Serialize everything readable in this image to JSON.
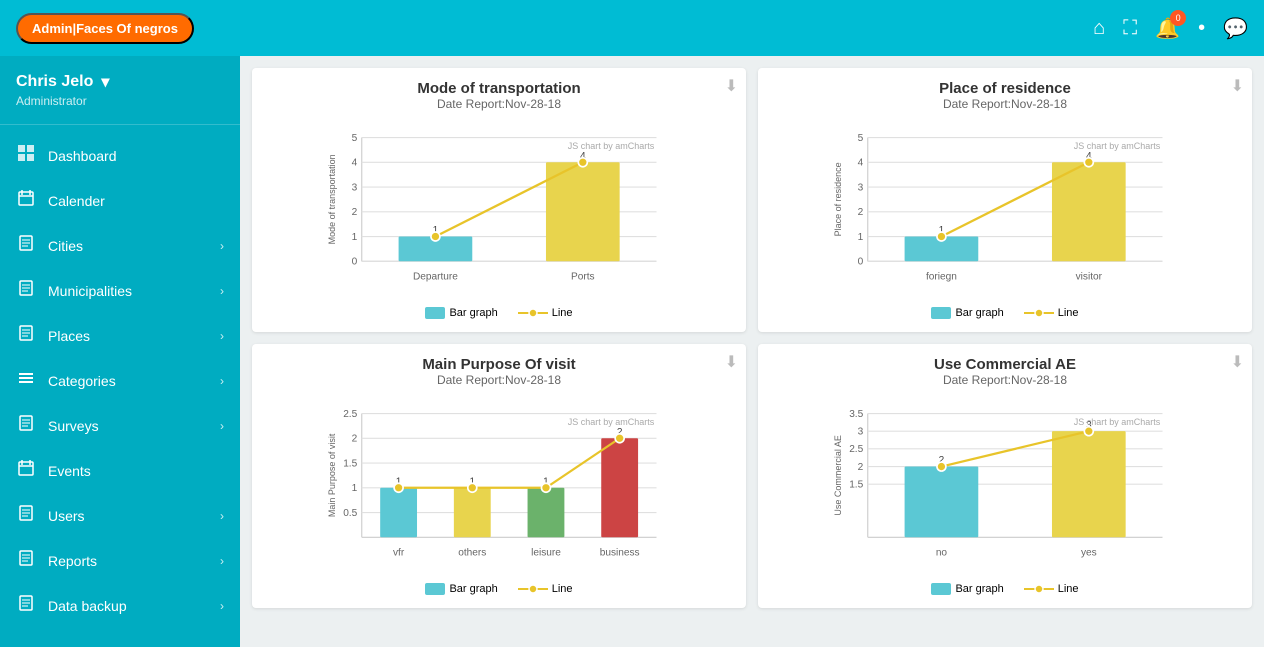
{
  "navbar": {
    "brand": "Admin|Faces Of negros",
    "icons": [
      "home",
      "expand",
      "bell",
      "user",
      "chat"
    ],
    "badge_count": "0"
  },
  "sidebar": {
    "user": {
      "name": "Chris Jelo",
      "role": "Administrator"
    },
    "items": [
      {
        "id": "dashboard",
        "label": "Dashboard",
        "icon": "▦",
        "has_arrow": false
      },
      {
        "id": "calender",
        "label": "Calender",
        "icon": "📅",
        "has_arrow": false
      },
      {
        "id": "cities",
        "label": "Cities",
        "icon": "📄",
        "has_arrow": true
      },
      {
        "id": "municipalities",
        "label": "Municipalities",
        "icon": "📄",
        "has_arrow": true
      },
      {
        "id": "places",
        "label": "Places",
        "icon": "📄",
        "has_arrow": true
      },
      {
        "id": "categories",
        "label": "Categories",
        "icon": "≡",
        "has_arrow": true
      },
      {
        "id": "surveys",
        "label": "Surveys",
        "icon": "📄",
        "has_arrow": true
      },
      {
        "id": "events",
        "label": "Events",
        "icon": "📅",
        "has_arrow": false
      },
      {
        "id": "users",
        "label": "Users",
        "icon": "📄",
        "has_arrow": true
      },
      {
        "id": "reports",
        "label": "Reports",
        "icon": "📄",
        "has_arrow": true
      },
      {
        "id": "data-backup",
        "label": "Data backup",
        "icon": "📄",
        "has_arrow": true
      }
    ]
  },
  "charts": [
    {
      "id": "mode-of-transportation",
      "title": "Mode of transportation",
      "date": "Date Report:Nov-28-18",
      "y_label": "Mode of transportation",
      "bars": [
        {
          "label": "Departure",
          "value": 1,
          "color": "#5BC8D4"
        },
        {
          "label": "Ports",
          "value": 4,
          "color": "#E8D44D"
        }
      ],
      "max_y": 5,
      "y_ticks": [
        0,
        1,
        2,
        3,
        4,
        5
      ],
      "amcharts_label": "JS chart by amCharts"
    },
    {
      "id": "place-of-residence",
      "title": "Place of residence",
      "date": "Date Report:Nov-28-18",
      "y_label": "Place of residence",
      "bars": [
        {
          "label": "foriegn",
          "value": 1,
          "color": "#5BC8D4"
        },
        {
          "label": "visitor",
          "value": 4,
          "color": "#E8D44D"
        }
      ],
      "max_y": 5,
      "y_ticks": [
        0,
        1,
        2,
        3,
        4,
        5
      ],
      "amcharts_label": "JS chart by amCharts"
    },
    {
      "id": "main-purpose-of-visit",
      "title": "Main Purpose Of visit",
      "date": "Date Report:Nov-28-18",
      "y_label": "Main Purpose of visit",
      "bars": [
        {
          "label": "vfr",
          "value": 1,
          "color": "#5BC8D4"
        },
        {
          "label": "others",
          "value": 1,
          "color": "#E8D44D"
        },
        {
          "label": "leisure",
          "value": 1,
          "color": "#6BB26B"
        },
        {
          "label": "business",
          "value": 2,
          "color": "#CC4444"
        }
      ],
      "max_y": 2.5,
      "y_ticks": [
        0.5,
        1.0,
        1.5,
        2.0,
        2.5
      ],
      "amcharts_label": "JS chart by amCharts"
    },
    {
      "id": "use-commercial-ae",
      "title": "Use Commercial AE",
      "date": "Date Report:Nov-28-18",
      "y_label": "Use Commercial AE",
      "bars": [
        {
          "label": "no",
          "value": 2,
          "color": "#5BC8D4"
        },
        {
          "label": "yes",
          "value": 3,
          "color": "#E8D44D"
        }
      ],
      "max_y": 3.5,
      "y_ticks": [
        1.5,
        2.0,
        2.5,
        3.0,
        3.5
      ],
      "amcharts_label": "JS chart by amCharts"
    }
  ],
  "legend": {
    "bar_label": "Bar graph",
    "line_label": "Line"
  }
}
